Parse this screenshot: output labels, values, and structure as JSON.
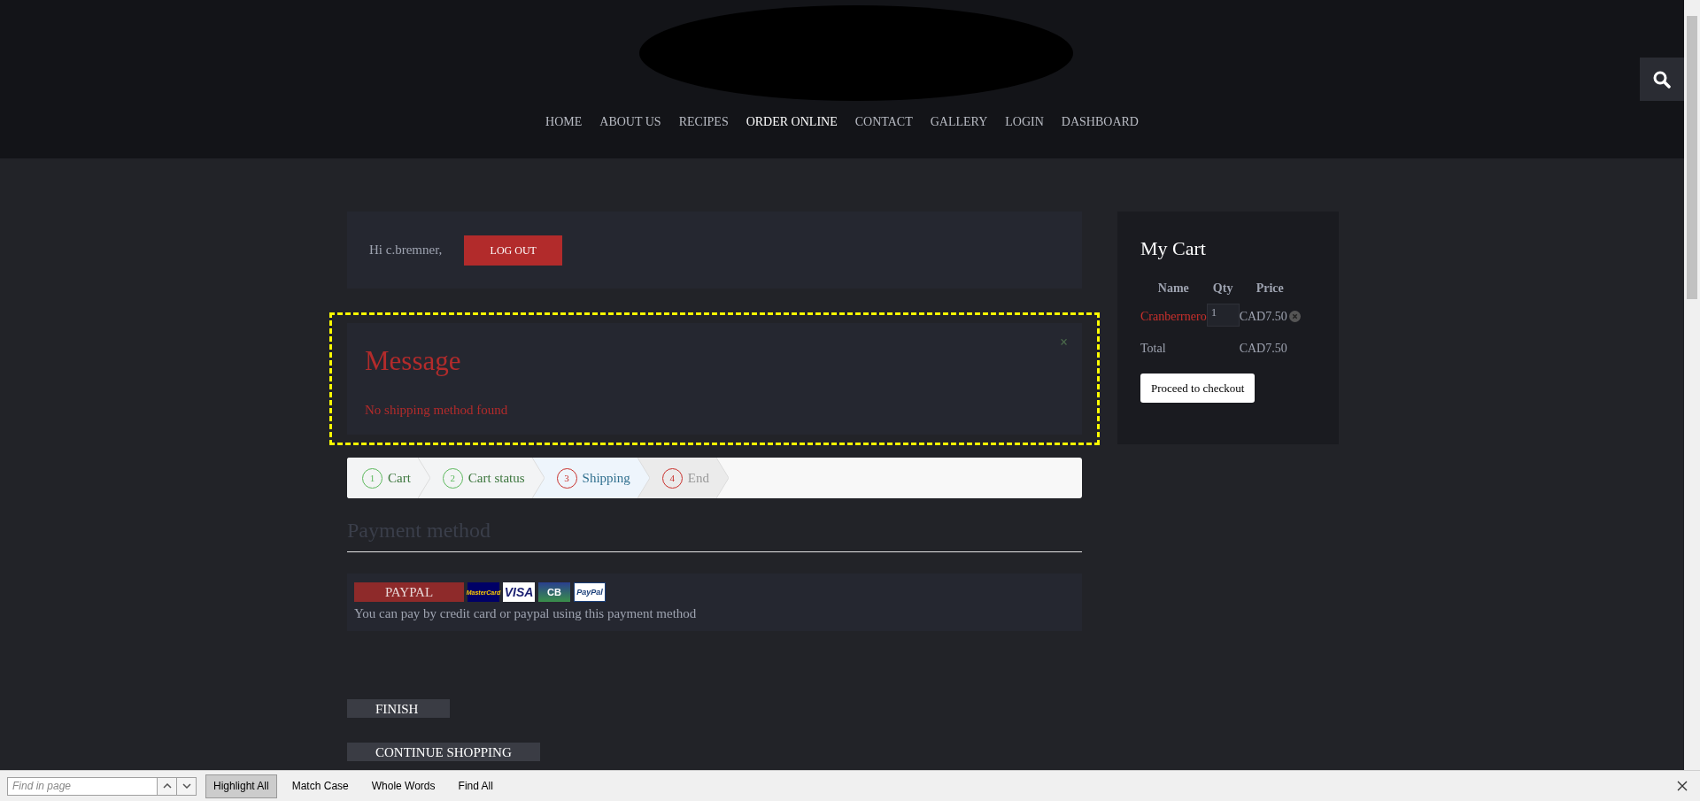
{
  "nav": [
    {
      "label": "HOME",
      "selected": false
    },
    {
      "label": "ABOUT US",
      "selected": false
    },
    {
      "label": "RECIPES",
      "selected": false
    },
    {
      "label": "ORDER ONLINE",
      "selected": true
    },
    {
      "label": "CONTACT",
      "selected": false
    },
    {
      "label": "GALLERY",
      "selected": false
    },
    {
      "label": "LOGIN",
      "selected": false
    },
    {
      "label": "DASHBOARD",
      "selected": false
    }
  ],
  "greeting": {
    "text": "Hi c.bremner,",
    "button": "LOG OUT"
  },
  "message": {
    "title": "Message",
    "close": "×",
    "text": "No shipping method found"
  },
  "steps": [
    {
      "number": "1",
      "label": "Cart",
      "kind": "done"
    },
    {
      "number": "2",
      "label": "Cart status",
      "kind": "done"
    },
    {
      "number": "3",
      "label": "Shipping",
      "kind": "current"
    },
    {
      "number": "4",
      "label": "End",
      "kind": "todo"
    }
  ],
  "payment": {
    "title": "Payment method",
    "method": "PAYPAL",
    "logos": [
      "MasterCard",
      "VISA",
      "CB",
      "PayPal"
    ],
    "description": "You can pay by credit card or paypal using this payment method"
  },
  "buttons": [
    "FINISH",
    "CONTINUE SHOPPING"
  ],
  "cart": {
    "title": "My Cart",
    "columns": [
      "Name",
      "Qty",
      "Price"
    ],
    "rows": [
      {
        "name": "Cranberrnero",
        "qty": "1",
        "price": "CAD7.50"
      }
    ],
    "total_label": "Total",
    "total": "CAD7.50",
    "checkout": "Proceed to checkout"
  },
  "find_bar": {
    "placeholder": "Find in page",
    "options": [
      {
        "label": "Highlight All",
        "pressed": true
      },
      {
        "label": "Match Case",
        "pressed": false
      },
      {
        "label": "Whole Words",
        "pressed": false
      },
      {
        "label": "Find All",
        "pressed": false
      }
    ]
  }
}
